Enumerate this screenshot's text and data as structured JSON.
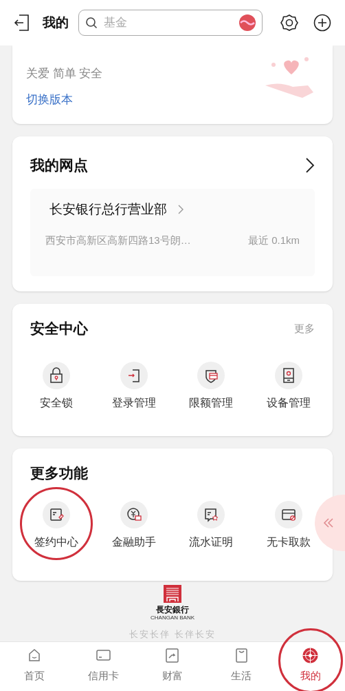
{
  "header": {
    "title": "我的",
    "search": {
      "placeholder": "基金"
    }
  },
  "version_card": {
    "tagline": "关爱 简单 安全",
    "link": "切换版本"
  },
  "branch_card": {
    "title": "我的网点",
    "branch": {
      "name": "长安银行总行营业部",
      "address": "西安市高新区高新四路13号朗…",
      "distance": "最近 0.1km"
    }
  },
  "security_card": {
    "title": "安全中心",
    "more": "更多",
    "items": [
      {
        "label": "安全锁",
        "kind": "lock",
        "circled": false
      },
      {
        "label": "登录管理",
        "kind": "login",
        "circled": false
      },
      {
        "label": "限额管理",
        "kind": "limit",
        "circled": false
      },
      {
        "label": "设备管理",
        "kind": "device",
        "circled": false
      }
    ]
  },
  "features_card": {
    "title": "更多功能",
    "items": [
      {
        "label": "签约中心",
        "kind": "sign",
        "circled": true
      },
      {
        "label": "金融助手",
        "kind": "finance",
        "circled": false
      },
      {
        "label": "流水证明",
        "kind": "statement",
        "circled": false
      },
      {
        "label": "无卡取款",
        "kind": "cardless",
        "circled": false
      }
    ]
  },
  "footer": {
    "logo_name": "長安銀行",
    "logo_english": "CHANGAN BANK",
    "slogan": "长安长伴 长伴长安"
  },
  "bottom_nav": [
    {
      "label": "首页",
      "kind": "home",
      "selected": false,
      "circled": false
    },
    {
      "label": "信用卡",
      "kind": "card",
      "selected": false,
      "circled": false
    },
    {
      "label": "财富",
      "kind": "wealth",
      "selected": false,
      "circled": false
    },
    {
      "label": "生活",
      "kind": "life",
      "selected": false,
      "circled": false
    },
    {
      "label": "我的",
      "kind": "mine",
      "selected": true,
      "circled": true
    }
  ]
}
